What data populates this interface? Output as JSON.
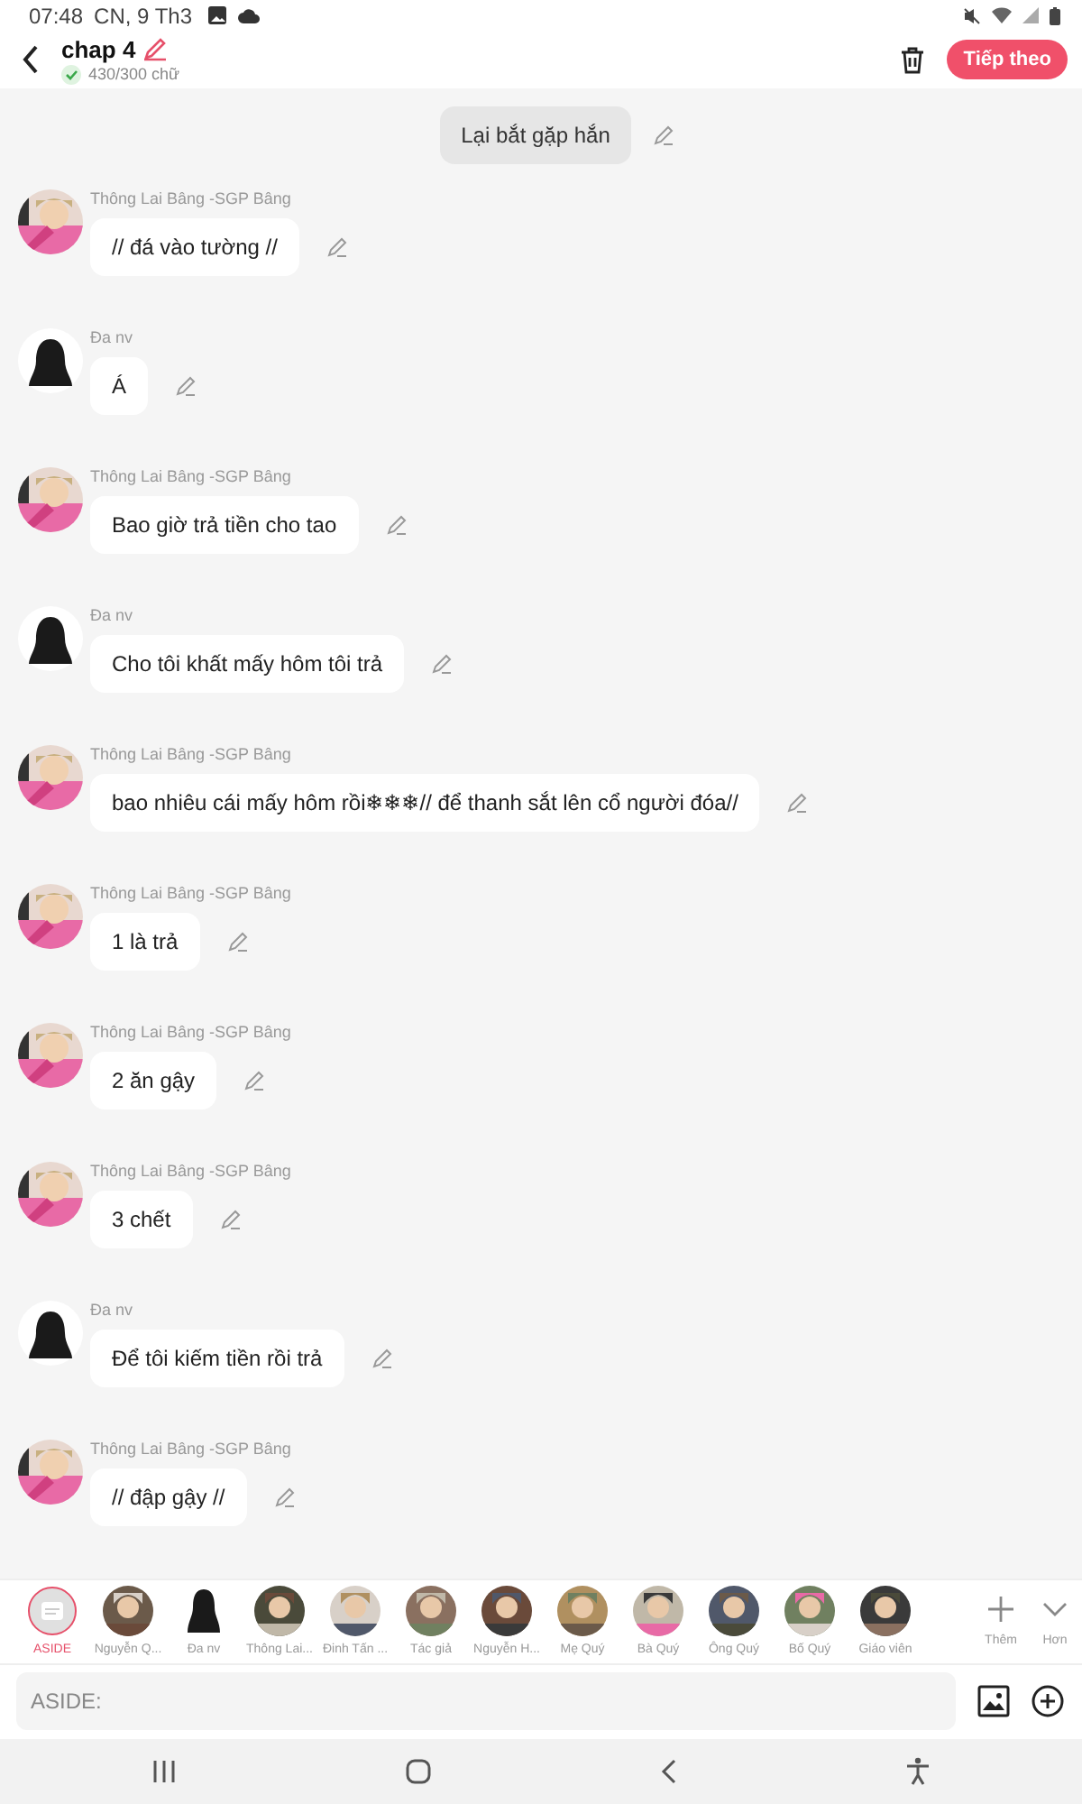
{
  "status_bar": {
    "time": "07:48",
    "date": "CN, 9 Th3"
  },
  "header": {
    "title": "chap 4",
    "word_count": "430/300 chữ",
    "next_button": "Tiếp theo"
  },
  "narration": {
    "text": "Lại bắt gặp hắn"
  },
  "messages": [
    {
      "speaker": "Thông Lai Bâng -SGP Bâng",
      "text": "// đá vào tường //"
    },
    {
      "speaker": "Đa nv",
      "kind": "silhouette",
      "text": "Á"
    },
    {
      "speaker": "Thông Lai Bâng -SGP Bâng",
      "text": "Bao giờ trả tiền cho tao"
    },
    {
      "speaker": "Đa nv",
      "kind": "silhouette",
      "text": "Cho tôi khất mấy hôm tôi trả"
    },
    {
      "speaker": "Thông Lai Bâng -SGP Bâng",
      "text": "bao nhiêu cái mấy hôm rồi❄❄❄// để thanh sắt lên cổ người đóa//"
    },
    {
      "speaker": "Thông Lai Bâng -SGP Bâng",
      "text": "1 là trả"
    },
    {
      "speaker": "Thông Lai Bâng -SGP Bâng",
      "text": "2 ăn gậy"
    },
    {
      "speaker": "Thông Lai Bâng -SGP Bâng",
      "text": "3 chết"
    },
    {
      "speaker": "Đa nv",
      "kind": "silhouette",
      "text": "Để tôi kiếm tiền rồi trả"
    },
    {
      "speaker": "Thông Lai Bâng -SGP Bâng",
      "text": "// đập gậy //"
    }
  ],
  "characters": [
    {
      "label": "ASIDE",
      "kind": "aside",
      "selected": true
    },
    {
      "label": "Nguyễn Q...",
      "kind": "picture",
      "selected": false
    },
    {
      "label": "Đa nv",
      "kind": "silhouette",
      "selected": false
    },
    {
      "label": "Thông Lai...",
      "kind": "picture",
      "selected": false
    },
    {
      "label": "Đinh Tấn ...",
      "kind": "picture",
      "selected": false
    },
    {
      "label": "Tác giả",
      "kind": "picture",
      "selected": false
    },
    {
      "label": "Nguyễn H...",
      "kind": "picture",
      "selected": false
    },
    {
      "label": "Mẹ Quý",
      "kind": "picture",
      "selected": false
    },
    {
      "label": "Bà Quý",
      "kind": "picture",
      "selected": false
    },
    {
      "label": "Ông Quý",
      "kind": "picture",
      "selected": false
    },
    {
      "label": "Bố Quý",
      "kind": "picture",
      "selected": false
    },
    {
      "label": "Giáo viên",
      "kind": "picture",
      "selected": false
    }
  ],
  "add_button": "Thêm",
  "more_button": "Hơn",
  "input": {
    "placeholder": "ASIDE:"
  }
}
